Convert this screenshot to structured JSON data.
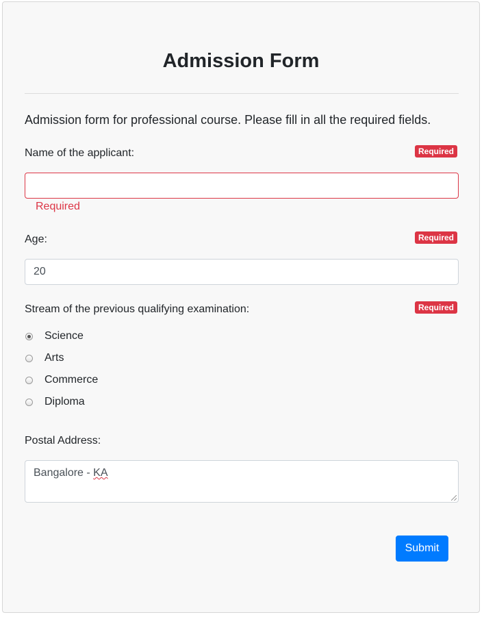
{
  "form": {
    "title": "Admission Form",
    "intro": "Admission form for professional course. Please fill in all the required fields.",
    "required_badge": "Required",
    "name": {
      "label": "Name of the applicant:",
      "value": "",
      "error": "Required"
    },
    "age": {
      "label": "Age:",
      "value": "20"
    },
    "stream": {
      "label": "Stream of the previous qualifying examination:",
      "selected": "Science",
      "options": [
        "Science",
        "Arts",
        "Commerce",
        "Diploma"
      ]
    },
    "address": {
      "label": "Postal Address:",
      "value_prefix": "Bangalore - ",
      "value_misspelled": "KA"
    },
    "submit_label": "Submit"
  },
  "colors": {
    "primary": "#007bff",
    "danger": "#dc3545",
    "card_background": "#f8f8f8"
  }
}
